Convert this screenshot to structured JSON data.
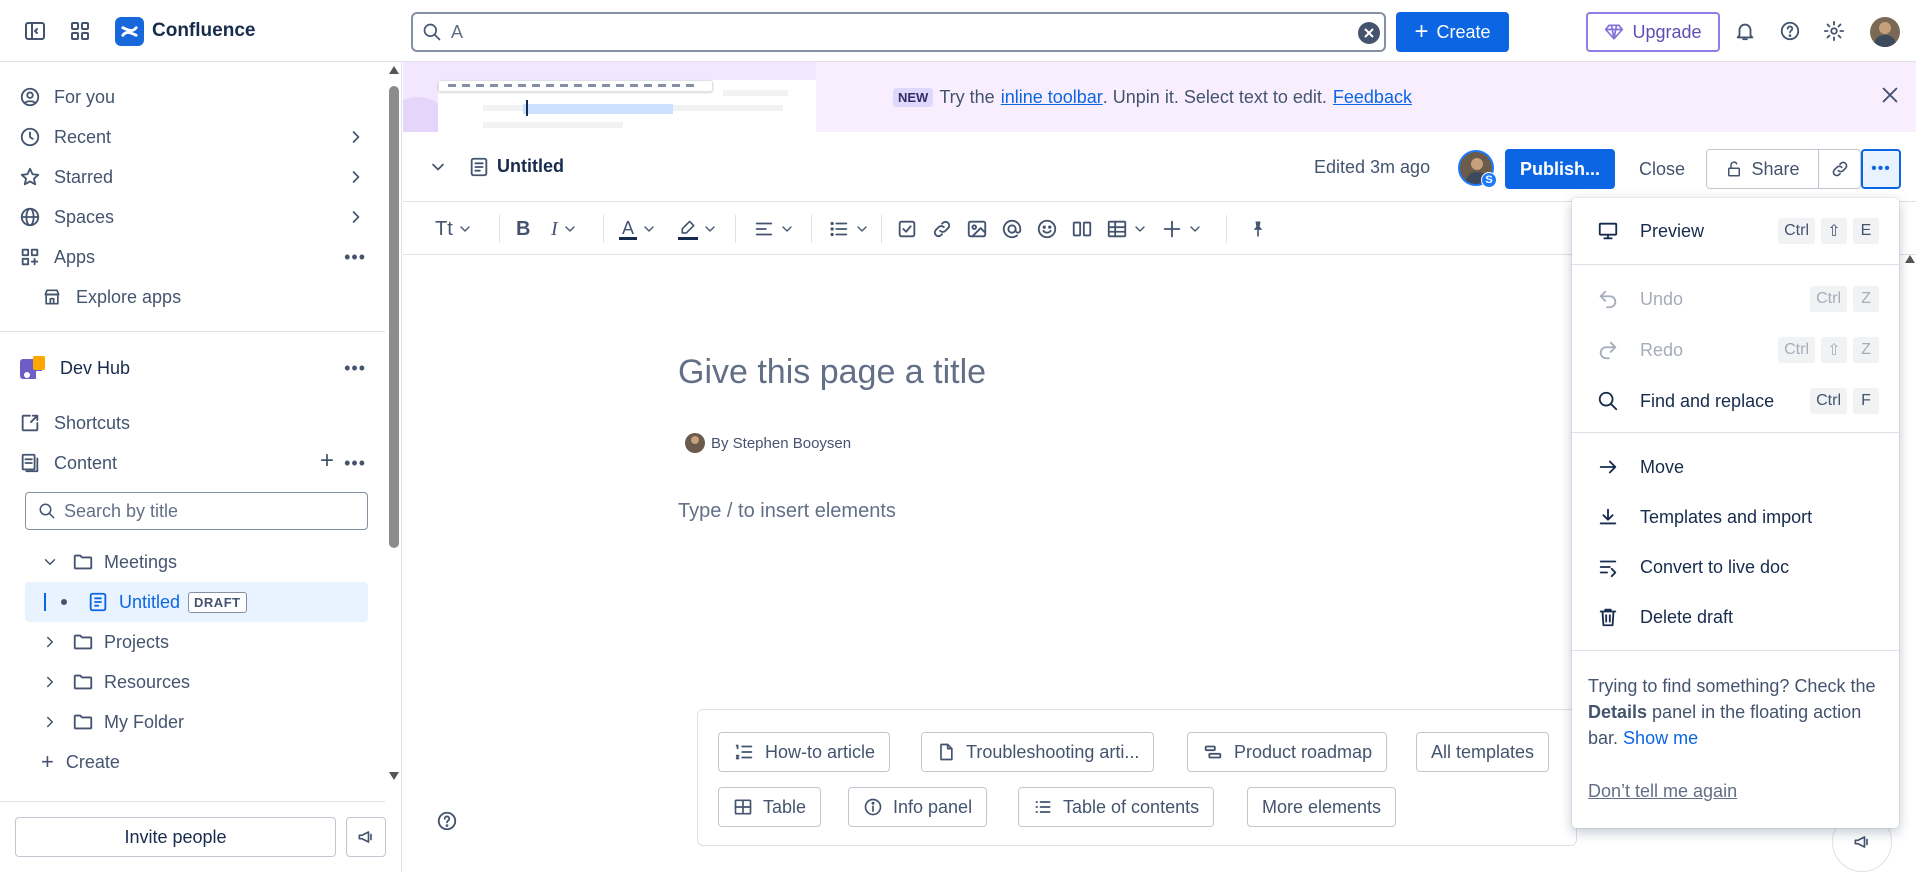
{
  "app": {
    "name": "Confluence"
  },
  "topbar": {
    "search_value": "A",
    "create_label": "Create",
    "upgrade_label": "Upgrade"
  },
  "sidebar": {
    "items": [
      {
        "label": "For you",
        "icon": "person-circle-icon"
      },
      {
        "label": "Recent",
        "icon": "clock-icon"
      },
      {
        "label": "Starred",
        "icon": "star-icon"
      },
      {
        "label": "Spaces",
        "icon": "globe-icon"
      },
      {
        "label": "Apps",
        "icon": "apps-icon"
      },
      {
        "label": "Explore apps",
        "icon": "marketplace-icon"
      }
    ],
    "space": {
      "name": "Dev Hub"
    },
    "shortcuts_label": "Shortcuts",
    "content_label": "Content",
    "search_placeholder": "Search by title",
    "tree": [
      {
        "label": "Meetings",
        "expanded": true
      },
      {
        "label": "Untitled",
        "badge": "DRAFT",
        "selected": true
      },
      {
        "label": "Projects"
      },
      {
        "label": "Resources"
      },
      {
        "label": "My Folder"
      }
    ],
    "create_label": "Create",
    "invite_label": "Invite people"
  },
  "banner": {
    "badge": "NEW",
    "text_before": "Try the",
    "link_text": "inline toolbar",
    "text_after": ". Unpin it. Select text to edit.",
    "feedback_link": "Feedback"
  },
  "page_header": {
    "title": "Untitled",
    "edited": "Edited 3m ago",
    "avatar_badge": "S",
    "publish_label": "Publish...",
    "close_label": "Close",
    "share_label": "Share"
  },
  "toolbar": {
    "text_style": "Tt"
  },
  "editor": {
    "title_placeholder": "Give this page a title",
    "byline": "By Stephen Booysen",
    "body_placeholder": "Type / to insert elements"
  },
  "templates": {
    "row1": [
      "How-to article",
      "Troubleshooting arti...",
      "Product roadmap",
      "All templates"
    ],
    "row2": [
      "Table",
      "Info panel",
      "Table of contents",
      "More elements"
    ]
  },
  "menu": {
    "items": [
      {
        "label": "Preview",
        "keys": [
          "Ctrl",
          "⇧",
          "E"
        ],
        "disabled": false
      },
      {
        "label": "Undo",
        "keys": [
          "Ctrl",
          "Z"
        ],
        "disabled": true
      },
      {
        "label": "Redo",
        "keys": [
          "Ctrl",
          "⇧",
          "Z"
        ],
        "disabled": true
      },
      {
        "label": "Find and replace",
        "keys": [
          "Ctrl",
          "F"
        ],
        "disabled": false
      },
      {
        "label": "Move"
      },
      {
        "label": "Templates and import"
      },
      {
        "label": "Convert to live doc"
      },
      {
        "label": "Delete draft"
      }
    ],
    "tip_1": "Trying to find something? Check the",
    "tip_bold": "Details",
    "tip_2": "panel in the floating action bar.",
    "tip_link": "Show me",
    "dismiss": "Don’t tell me again"
  },
  "colors": {
    "primary": "#0c66e4",
    "upgrade": "#5e4db2",
    "banner_bg": "#f8eefe",
    "selected_bg": "#e9f2ff"
  }
}
